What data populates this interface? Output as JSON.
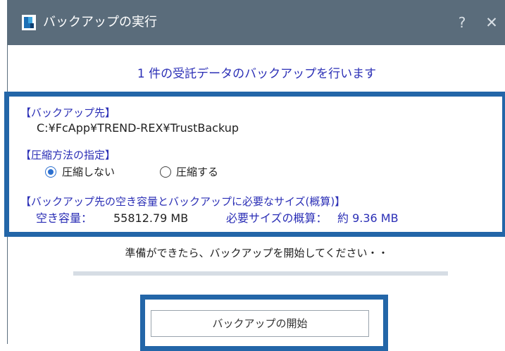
{
  "window": {
    "title": "バックアップの実行",
    "help_glyph": "?",
    "close_glyph": "✕",
    "icon": "app-icon"
  },
  "headline": "1 件の受託データのバックアップを行います",
  "destination": {
    "label": "【バックアップ先】",
    "path": "C:¥FcApp¥TREND-REX¥TrustBackup"
  },
  "compression": {
    "label": "【圧縮方法の指定】",
    "options": [
      {
        "label": "圧縮しない",
        "selected": true
      },
      {
        "label": "圧縮する",
        "selected": false
      }
    ]
  },
  "capacity": {
    "label": "【バックアップ先の空き容量とバックアップに必要なサイズ(概算)】",
    "free_label": "空き容量：",
    "free_value": "55812.79 MB",
    "required_label": "必要サイズの概算：",
    "required_value": "約 9.36 MB"
  },
  "status_text": "準備ができたら、バックアップを開始してください・・",
  "progress": 0,
  "start_button": "バックアップの開始",
  "colors": {
    "titlebar": "#5a6c7b",
    "accent_text": "#2b2fb6",
    "highlight_border": "#2366a8",
    "radio_selected": "#2b6fcf"
  }
}
